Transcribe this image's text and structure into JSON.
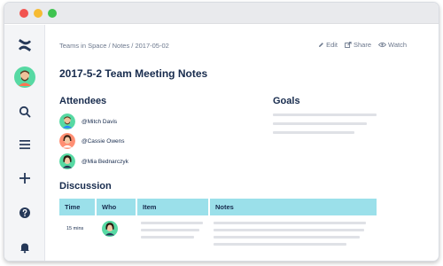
{
  "window": {
    "controls": [
      "close",
      "minimize",
      "maximize"
    ]
  },
  "sidebar": {
    "items": [
      {
        "name": "confluence-logo-icon",
        "color": "#253858"
      },
      {
        "name": "user-avatar",
        "color": "#57d9a3"
      },
      {
        "name": "search-icon"
      },
      {
        "name": "menu-icon"
      },
      {
        "name": "create-icon"
      },
      {
        "name": "help-icon"
      },
      {
        "name": "notifications-icon"
      }
    ]
  },
  "header": {
    "breadcrumb": "Teams in Space / Notes / 2017-05-02",
    "actions": {
      "edit": "Edit",
      "share": "Share",
      "watch": "Watch"
    }
  },
  "page": {
    "title": "2017-5-2 Team Meeting Notes"
  },
  "attendees": {
    "heading": "Attendees",
    "people": [
      {
        "name": "@Mitch Davis",
        "avatar_color": "#57d9a3"
      },
      {
        "name": "@Cassie Owens",
        "avatar_color": "#ff8f73"
      },
      {
        "name": "@Mia Bednarczyk",
        "avatar_color": "#57d9a3"
      }
    ]
  },
  "goals": {
    "heading": "Goals"
  },
  "discussion": {
    "heading": "Discussion",
    "columns": [
      "Time",
      "Who",
      "Item",
      "Notes"
    ],
    "rows": [
      {
        "time": "15 mins",
        "avatar_color": "#57d9a3"
      }
    ]
  },
  "colors": {
    "table_header": "#9be0ea",
    "placeholder_text": "#dfe1e6",
    "text_primary": "#172b4d",
    "text_secondary": "#6b778c"
  }
}
